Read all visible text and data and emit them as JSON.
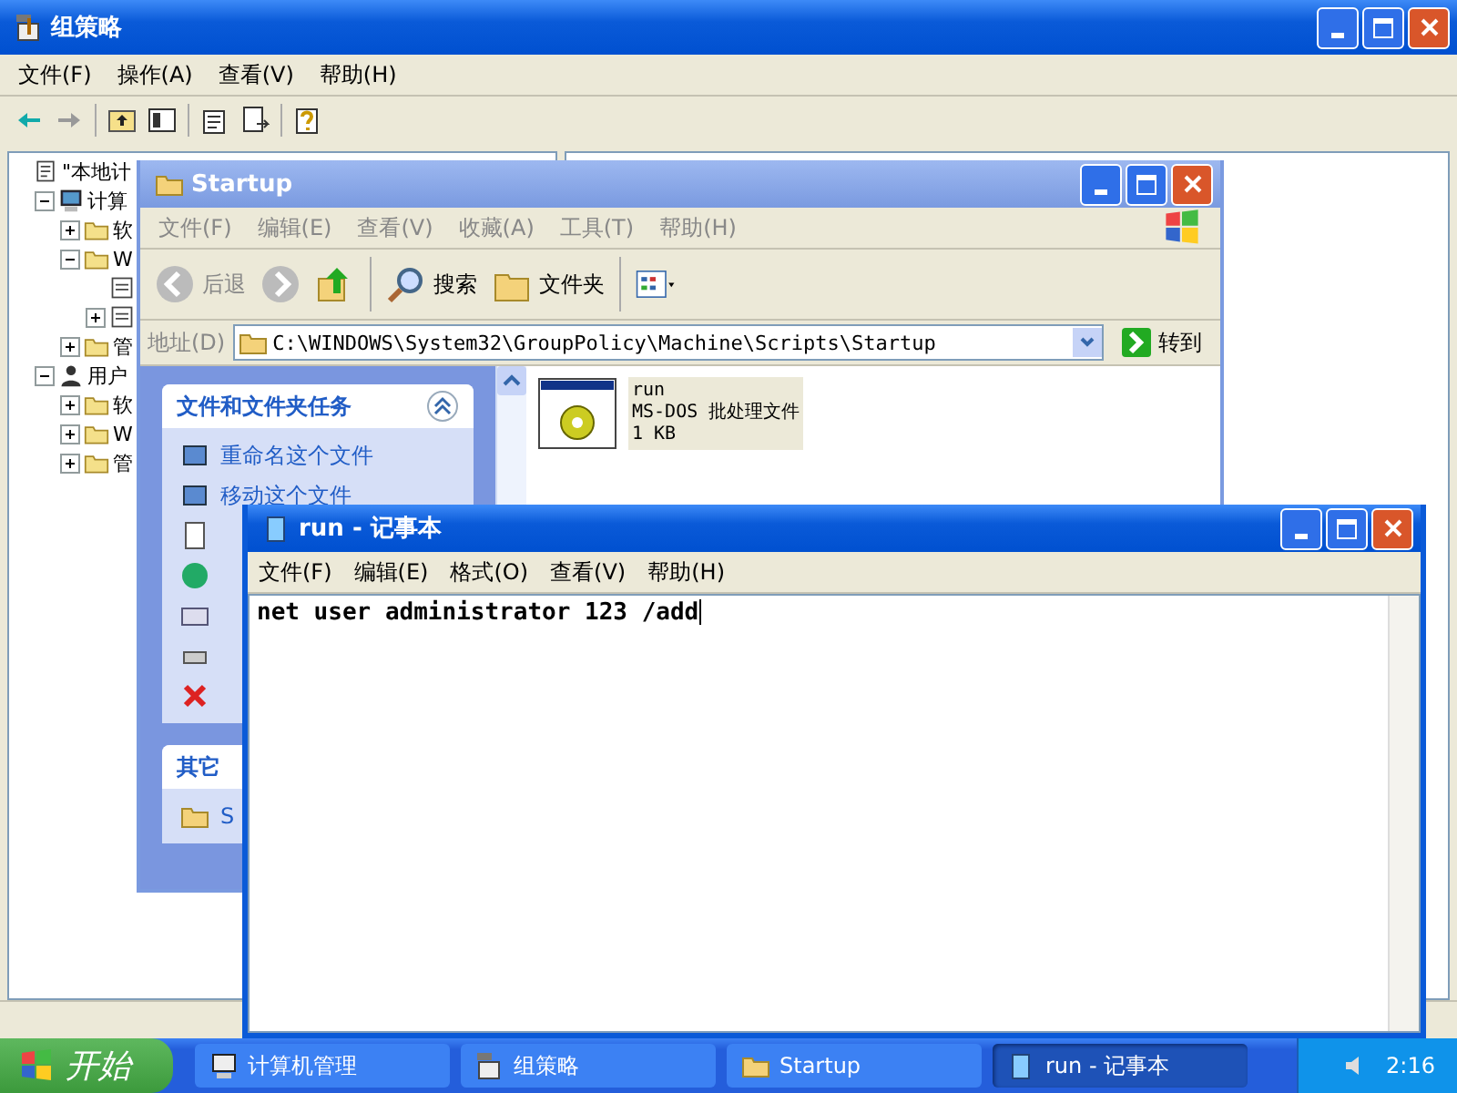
{
  "gp_window": {
    "title": "组策略",
    "menu": [
      "文件(F)",
      "操作(A)",
      "查看(V)",
      "帮助(H)"
    ],
    "tree": [
      {
        "label": "\"本地计",
        "kind": "policy",
        "children": [
          {
            "label": "计算",
            "kind": "computer",
            "expanded": true,
            "children": [
              {
                "label": "软",
                "kind": "folder",
                "expanded": false
              },
              {
                "label": "W",
                "kind": "folder",
                "expanded": true,
                "children": [
                  {
                    "kind": "script"
                  },
                  {
                    "kind": "script",
                    "expanded": false
                  }
                ]
              },
              {
                "label": "管",
                "kind": "folder",
                "expanded": false
              }
            ]
          },
          {
            "label": "用户",
            "kind": "user",
            "expanded": true,
            "children": [
              {
                "label": "软",
                "kind": "folder",
                "expanded": false
              },
              {
                "label": "W",
                "kind": "folder",
                "expanded": false
              },
              {
                "label": "管",
                "kind": "folder",
                "expanded": false
              }
            ]
          }
        ]
      }
    ]
  },
  "explorer": {
    "title": "Startup",
    "menu": [
      "文件(F)",
      "编辑(E)",
      "查看(V)",
      "收藏(A)",
      "工具(T)",
      "帮助(H)"
    ],
    "toolbar": {
      "back": "后退",
      "search": "搜索",
      "folders": "文件夹"
    },
    "address": {
      "label": "地址(D)",
      "value": "C:\\WINDOWS\\System32\\GroupPolicy\\Machine\\Scripts\\Startup",
      "go": "转到"
    },
    "tasks": {
      "title": "文件和文件夹任务",
      "items": [
        "重命名这个文件",
        "移动这个文件"
      ]
    },
    "other_places": {
      "title": "其它",
      "items": [
        "S"
      ]
    },
    "files": [
      {
        "name": "run",
        "type": "MS-DOS 批处理文件",
        "size": "1 KB",
        "selected": true
      }
    ]
  },
  "notepad": {
    "title": "run - 记事本",
    "menu": [
      "文件(F)",
      "编辑(E)",
      "格式(O)",
      "查看(V)",
      "帮助(H)"
    ],
    "text": "net user administrator 123 /add"
  },
  "taskbar": {
    "start": "开始",
    "items": [
      {
        "label": "计算机管理",
        "kind": "computer",
        "selected": false
      },
      {
        "label": "组策略",
        "kind": "policy",
        "selected": false
      },
      {
        "label": "Startup",
        "kind": "folder",
        "selected": false
      },
      {
        "label": "run - 记事本",
        "kind": "notepad",
        "selected": true
      }
    ],
    "clock": "2:16"
  }
}
